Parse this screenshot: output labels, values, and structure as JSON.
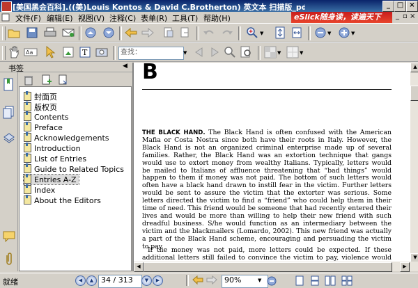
{
  "window": {
    "title": "[美国黑会百科].((美)Louis Kontos & David C.Brotherton) 英文本 扫描版_pdf - 福昕阅读器 - [美..."
  },
  "menu": {
    "items": [
      "文件(F)",
      "编辑(E)",
      "视图(V)",
      "注释(C)",
      "表单(R)",
      "工具(T)",
      "帮助(H)"
    ],
    "banner": "eSlick随身读，读遍天下书！"
  },
  "toolbar": {
    "search_placeholder": "查找："
  },
  "bookmarks": {
    "panel_title": "书签",
    "items": [
      "封面页",
      "版权页",
      "Contents",
      "Preface",
      "Acknowledgements",
      "Introduction",
      "List of Entries",
      "Guide to Related Topics",
      "Entries A-Z",
      "Index",
      "About the Editors"
    ],
    "selected": "Entries A-Z"
  },
  "document": {
    "letter": "B",
    "entry_heading": "THE BLACK HAND.",
    "paragraph1": "The Black Hand is often confused with the American Mafia or Costa Nostra since both have their roots in Italy. However, the Black Hand is not an organized criminal enterprise made up of several families. Rather, the Black Hand was an extortion technique that gangs would use to extort money from wealthy Italians. Typically, letters would be mailed to Italians of affluence threatening that “bad things” would happen to them if money was not paid. The bottom of such letters would often have a black hand drawn to instill fear in the victim. Further letters would be sent to assure the victim that the extorter was serious. Some letters directed the victim to find a “friend” who could help them in their time of need. This friend would be someone that had recently entered their lives and would be more than willing to help their new friend with such dreadful business. S/he would function as an intermediary between the victim and the blackmailers (Lomardo, 2002). This new friend was actually a part of the Black Hand scheme, encouraging and persuading the victim to pay.",
    "paragraph2": "If the money was not paid, more letters could be expected. If these additional letters still failed to convince the victim to pay, violence would often ensue. Victims"
  },
  "status": {
    "text": "就绪",
    "page_field": "34 / 313",
    "zoom": "90%"
  },
  "colors": {
    "titlebar": "#0a246a",
    "banner": "#c81d1d",
    "panel": "#d4d0c8"
  }
}
